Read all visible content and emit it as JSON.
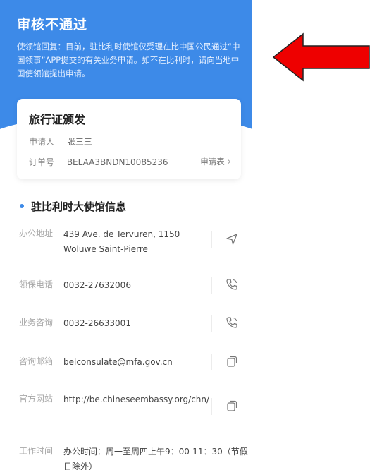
{
  "status": {
    "title": "审核不通过",
    "description": "使领馆回复：目前，驻比利时使馆仅受理在比中国公民通过“中国领事”APP提交的有关业务申请。如不在比利时，请向当地中国使领馆提出申请。"
  },
  "card": {
    "title": "旅行证颁发",
    "applicant_label": "申请人",
    "applicant_value": "张三三",
    "order_label": "订单号",
    "order_value": "BELAA3BNDN10085236",
    "form_link": "申请表",
    "form_chevron": "›"
  },
  "section": {
    "title": "驻比利时大使馆信息"
  },
  "info": {
    "address_label": "办公地址",
    "address_value": "439 Ave. de Tervuren, 1150 Woluwe Saint-Pierre",
    "consular_phone_label": "领保电话",
    "consular_phone_value": "0032-27632006",
    "business_phone_label": "业务咨询",
    "business_phone_value": "0032-26633001",
    "email_label": "咨询邮箱",
    "email_value": "belconsulate@mfa.gov.cn",
    "website_label": "官方网站",
    "website_value": "http://be.chineseembassy.org/chn/",
    "hours_label": "工作时间",
    "hours_value": "办公时间：周一至周四上午9：00-11：30（节假日除外）"
  },
  "icons": {
    "navigate": "navigate-icon",
    "phone": "phone-icon",
    "copy": "copy-icon",
    "annotation_arrow": "red-arrow-icon"
  },
  "colors": {
    "banner": "#3d8ae8",
    "arrow": "#ee0000"
  }
}
